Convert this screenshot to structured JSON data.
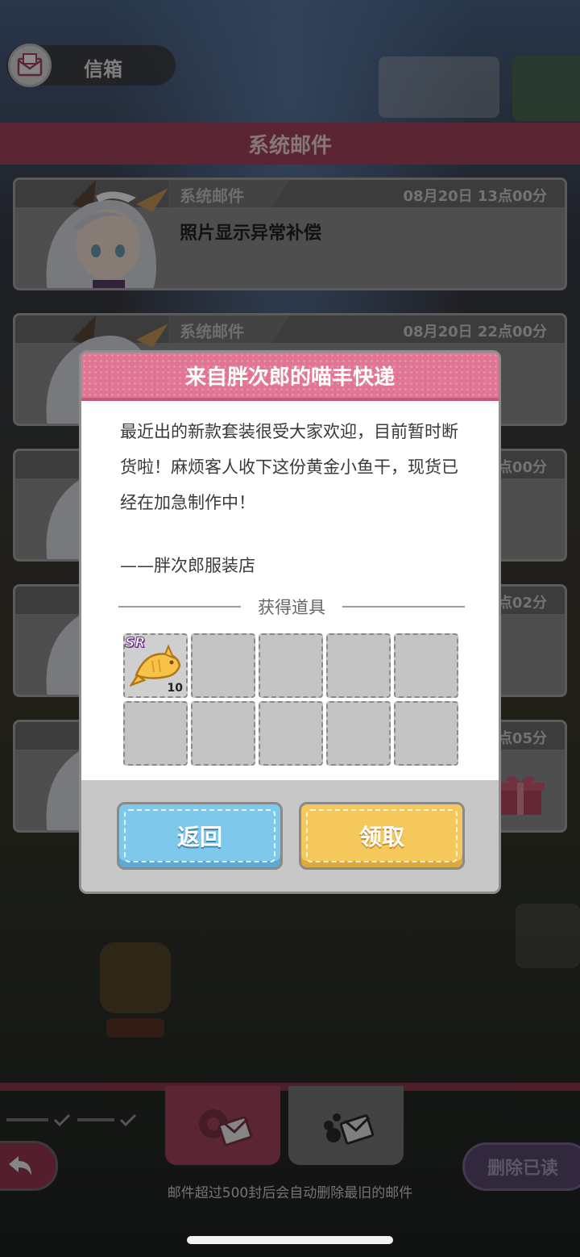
{
  "header": {
    "title": "信箱",
    "section_title": "系统邮件"
  },
  "mails": [
    {
      "from": "系统邮件",
      "time": "08月20日 13点00分",
      "subject": "照片显示异常补偿"
    },
    {
      "from": "系统邮件",
      "time": "08月20日 22点00分",
      "subject": ""
    },
    {
      "from": "",
      "time": "点00分",
      "subject": ""
    },
    {
      "from": "",
      "time": "点02分",
      "subject": ""
    },
    {
      "from": "",
      "time": "点05分",
      "subject": ""
    }
  ],
  "modal": {
    "title": "来自胖次郎的喵丰快递",
    "message": "最近出的新款套装很受大家欢迎，目前暂时断货啦！麻烦客人收下这份黄金小鱼干，现货已经在加急制作中！",
    "signature": "——胖次郎服装店",
    "items_label": "获得道具",
    "items": [
      {
        "rarity": "SR",
        "icon": "golden-fish-icon",
        "quantity": "10"
      }
    ],
    "back_label": "返回",
    "claim_label": "领取"
  },
  "footer": {
    "delete_read_label": "删除已读",
    "note": "邮件超过500封后会自动删除最旧的邮件"
  },
  "colors": {
    "accent": "#a8445d",
    "modal_header": "#e07693",
    "back_button": "#7ec8ec",
    "claim_button": "#f5c85c"
  }
}
